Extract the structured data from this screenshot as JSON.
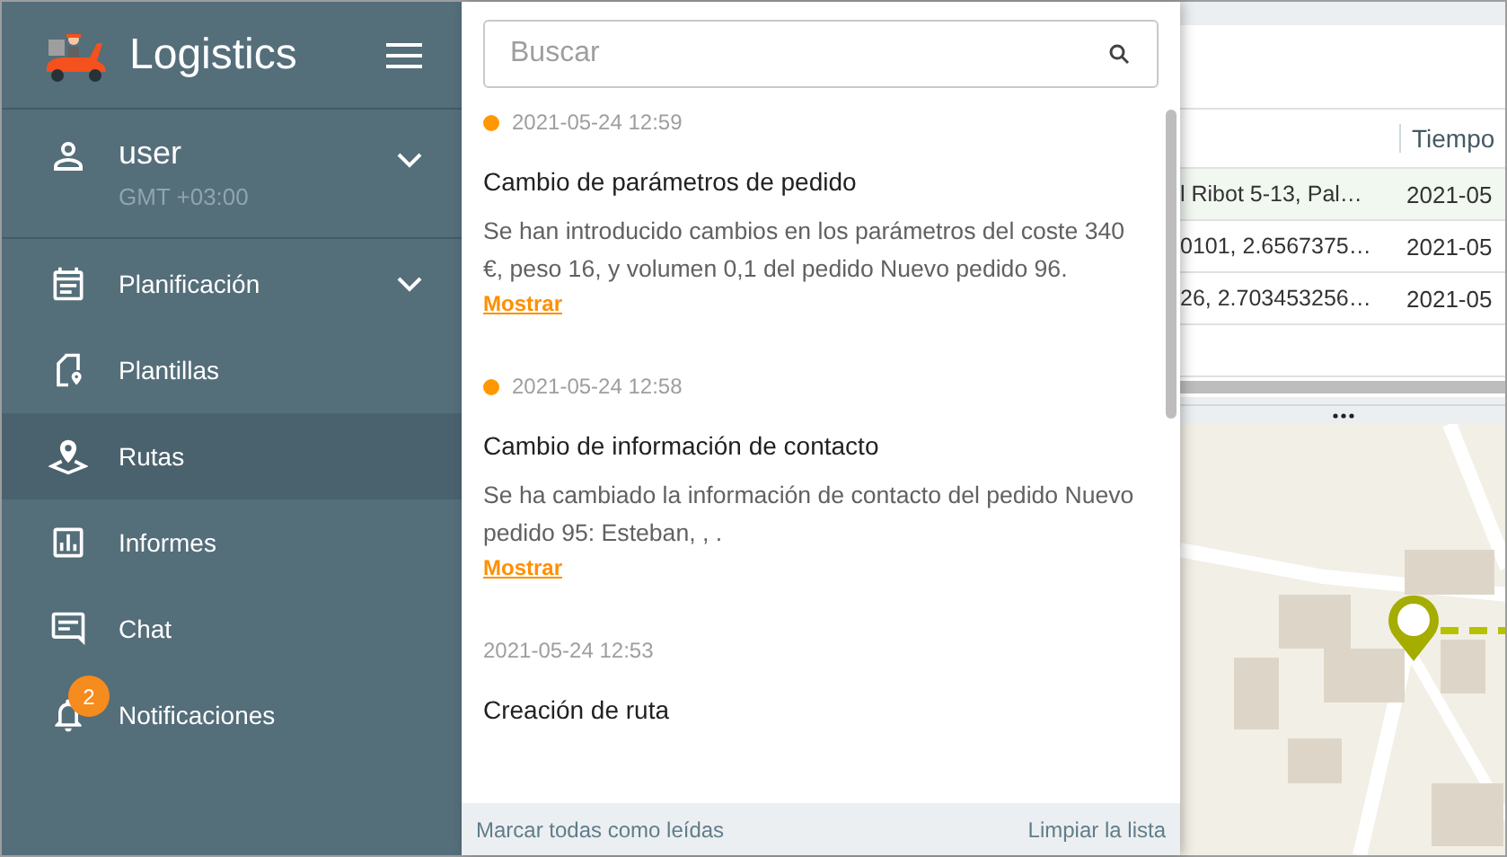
{
  "app": {
    "title": "Logistics"
  },
  "user": {
    "name": "user",
    "timezone": "GMT +03:00",
    "expanded": false
  },
  "sidebar": {
    "items": [
      {
        "label": "Planificación",
        "selected": false,
        "expanded": false
      },
      {
        "label": "Plantillas",
        "selected": false
      },
      {
        "label": "Rutas",
        "selected": true
      },
      {
        "label": "Informes",
        "selected": false
      },
      {
        "label": "Chat",
        "selected": false
      },
      {
        "label": "Notificaciones",
        "selected": false,
        "badge": "2"
      }
    ]
  },
  "notifications": {
    "search": {
      "placeholder": "Buscar"
    },
    "items": [
      {
        "time": "2021-05-24 12:59",
        "unread": true,
        "title": "Cambio de parámetros de pedido",
        "body": "Se han introducido cambios en los parámetros del coste 340 €, peso 16, y volumen 0,1 del pedido Nuevo pedido 96.",
        "link": "Mostrar"
      },
      {
        "time": "2021-05-24 12:58",
        "unread": true,
        "title": "Cambio de información de contacto",
        "body": "Se ha cambiado la información de contacto del pedido Nuevo pedido 95: Esteban, , .",
        "link": "Mostrar"
      },
      {
        "time": "2021-05-24 12:53",
        "unread": false,
        "title": "Creación de ruta"
      }
    ],
    "footer": {
      "mark_all": "Marcar todas como leídas",
      "clear": "Limpiar la lista"
    }
  },
  "table": {
    "columns": [
      "Tiempo"
    ],
    "rows": [
      {
        "column_1": "l Ribot 5-13, Pal…",
        "column_2": "2021-05",
        "selected": true
      },
      {
        "column_1": "0101, 2.6567375…",
        "column_2": "2021-05",
        "selected": false
      },
      {
        "column_1": "26, 2.703453256…",
        "column_2": "2021-05",
        "selected": false
      }
    ]
  }
}
